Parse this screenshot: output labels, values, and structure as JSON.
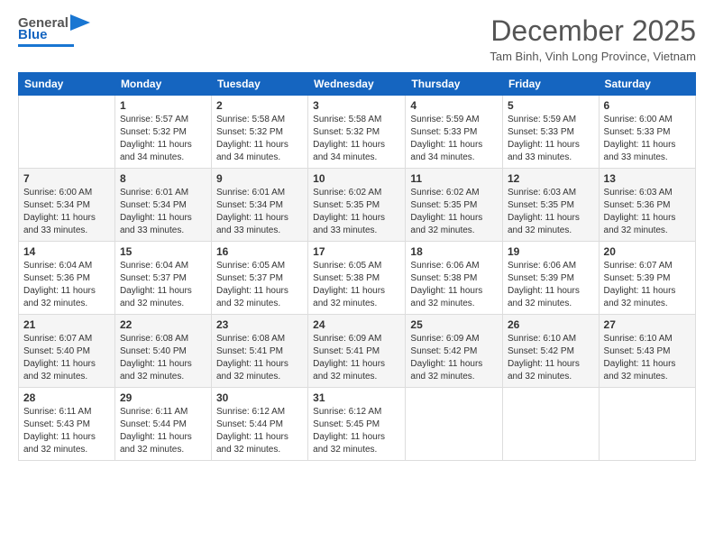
{
  "header": {
    "logo_general": "General",
    "logo_blue": "Blue",
    "month_title": "December 2025",
    "location": "Tam Binh, Vinh Long Province, Vietnam"
  },
  "weekdays": [
    "Sunday",
    "Monday",
    "Tuesday",
    "Wednesday",
    "Thursday",
    "Friday",
    "Saturday"
  ],
  "weeks": [
    [
      {
        "day": "",
        "info": ""
      },
      {
        "day": "1",
        "info": "Sunrise: 5:57 AM\nSunset: 5:32 PM\nDaylight: 11 hours\nand 34 minutes."
      },
      {
        "day": "2",
        "info": "Sunrise: 5:58 AM\nSunset: 5:32 PM\nDaylight: 11 hours\nand 34 minutes."
      },
      {
        "day": "3",
        "info": "Sunrise: 5:58 AM\nSunset: 5:32 PM\nDaylight: 11 hours\nand 34 minutes."
      },
      {
        "day": "4",
        "info": "Sunrise: 5:59 AM\nSunset: 5:33 PM\nDaylight: 11 hours\nand 34 minutes."
      },
      {
        "day": "5",
        "info": "Sunrise: 5:59 AM\nSunset: 5:33 PM\nDaylight: 11 hours\nand 33 minutes."
      },
      {
        "day": "6",
        "info": "Sunrise: 6:00 AM\nSunset: 5:33 PM\nDaylight: 11 hours\nand 33 minutes."
      }
    ],
    [
      {
        "day": "7",
        "info": "Sunrise: 6:00 AM\nSunset: 5:34 PM\nDaylight: 11 hours\nand 33 minutes."
      },
      {
        "day": "8",
        "info": "Sunrise: 6:01 AM\nSunset: 5:34 PM\nDaylight: 11 hours\nand 33 minutes."
      },
      {
        "day": "9",
        "info": "Sunrise: 6:01 AM\nSunset: 5:34 PM\nDaylight: 11 hours\nand 33 minutes."
      },
      {
        "day": "10",
        "info": "Sunrise: 6:02 AM\nSunset: 5:35 PM\nDaylight: 11 hours\nand 33 minutes."
      },
      {
        "day": "11",
        "info": "Sunrise: 6:02 AM\nSunset: 5:35 PM\nDaylight: 11 hours\nand 32 minutes."
      },
      {
        "day": "12",
        "info": "Sunrise: 6:03 AM\nSunset: 5:35 PM\nDaylight: 11 hours\nand 32 minutes."
      },
      {
        "day": "13",
        "info": "Sunrise: 6:03 AM\nSunset: 5:36 PM\nDaylight: 11 hours\nand 32 minutes."
      }
    ],
    [
      {
        "day": "14",
        "info": "Sunrise: 6:04 AM\nSunset: 5:36 PM\nDaylight: 11 hours\nand 32 minutes."
      },
      {
        "day": "15",
        "info": "Sunrise: 6:04 AM\nSunset: 5:37 PM\nDaylight: 11 hours\nand 32 minutes."
      },
      {
        "day": "16",
        "info": "Sunrise: 6:05 AM\nSunset: 5:37 PM\nDaylight: 11 hours\nand 32 minutes."
      },
      {
        "day": "17",
        "info": "Sunrise: 6:05 AM\nSunset: 5:38 PM\nDaylight: 11 hours\nand 32 minutes."
      },
      {
        "day": "18",
        "info": "Sunrise: 6:06 AM\nSunset: 5:38 PM\nDaylight: 11 hours\nand 32 minutes."
      },
      {
        "day": "19",
        "info": "Sunrise: 6:06 AM\nSunset: 5:39 PM\nDaylight: 11 hours\nand 32 minutes."
      },
      {
        "day": "20",
        "info": "Sunrise: 6:07 AM\nSunset: 5:39 PM\nDaylight: 11 hours\nand 32 minutes."
      }
    ],
    [
      {
        "day": "21",
        "info": "Sunrise: 6:07 AM\nSunset: 5:40 PM\nDaylight: 11 hours\nand 32 minutes."
      },
      {
        "day": "22",
        "info": "Sunrise: 6:08 AM\nSunset: 5:40 PM\nDaylight: 11 hours\nand 32 minutes."
      },
      {
        "day": "23",
        "info": "Sunrise: 6:08 AM\nSunset: 5:41 PM\nDaylight: 11 hours\nand 32 minutes."
      },
      {
        "day": "24",
        "info": "Sunrise: 6:09 AM\nSunset: 5:41 PM\nDaylight: 11 hours\nand 32 minutes."
      },
      {
        "day": "25",
        "info": "Sunrise: 6:09 AM\nSunset: 5:42 PM\nDaylight: 11 hours\nand 32 minutes."
      },
      {
        "day": "26",
        "info": "Sunrise: 6:10 AM\nSunset: 5:42 PM\nDaylight: 11 hours\nand 32 minutes."
      },
      {
        "day": "27",
        "info": "Sunrise: 6:10 AM\nSunset: 5:43 PM\nDaylight: 11 hours\nand 32 minutes."
      }
    ],
    [
      {
        "day": "28",
        "info": "Sunrise: 6:11 AM\nSunset: 5:43 PM\nDaylight: 11 hours\nand 32 minutes."
      },
      {
        "day": "29",
        "info": "Sunrise: 6:11 AM\nSunset: 5:44 PM\nDaylight: 11 hours\nand 32 minutes."
      },
      {
        "day": "30",
        "info": "Sunrise: 6:12 AM\nSunset: 5:44 PM\nDaylight: 11 hours\nand 32 minutes."
      },
      {
        "day": "31",
        "info": "Sunrise: 6:12 AM\nSunset: 5:45 PM\nDaylight: 11 hours\nand 32 minutes."
      },
      {
        "day": "",
        "info": ""
      },
      {
        "day": "",
        "info": ""
      },
      {
        "day": "",
        "info": ""
      }
    ]
  ]
}
